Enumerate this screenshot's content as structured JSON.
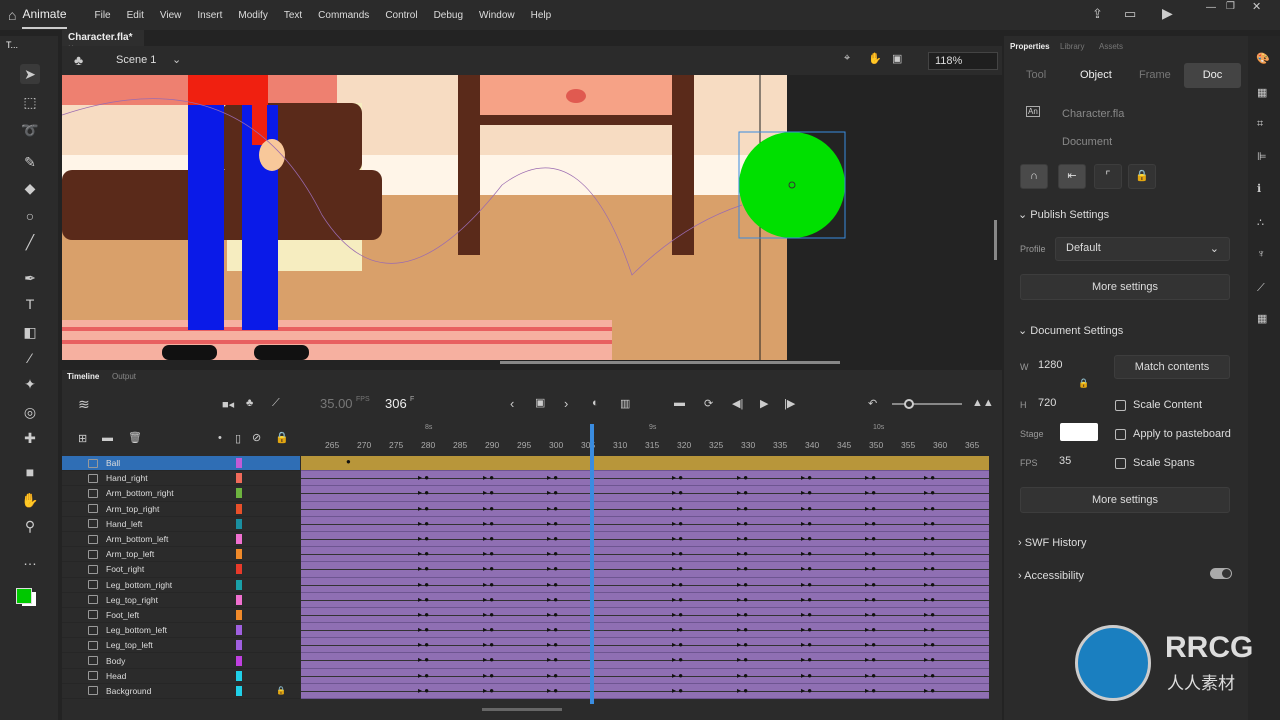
{
  "app": {
    "name": "Animate",
    "menu": [
      "File",
      "Edit",
      "View",
      "Insert",
      "Modify",
      "Text",
      "Commands",
      "Control",
      "Debug",
      "Window",
      "Help"
    ]
  },
  "tools_panel": {
    "title": "T..."
  },
  "document": {
    "tab": "Character.fla*",
    "scene": "Scene 1",
    "zoom": "118%"
  },
  "timeline": {
    "tabs": [
      "Timeline",
      "Output"
    ],
    "fps": "35.00",
    "fps_unit": "FPS",
    "frame": "306",
    "frame_unit": "F",
    "ruler": [
      "265",
      "270",
      "275",
      "280",
      "285",
      "290",
      "295",
      "300",
      "305",
      "310",
      "315",
      "320",
      "325",
      "330",
      "335",
      "340",
      "345",
      "350",
      "355",
      "360",
      "365"
    ],
    "seconds": [
      "8s",
      "9s",
      "10s"
    ],
    "current_frame": 306,
    "layers": [
      {
        "name": "Ball",
        "color": "#c35bd6"
      },
      {
        "name": "Hand_right",
        "color": "#f06a5a"
      },
      {
        "name": "Arm_bottom_right",
        "color": "#6db33f"
      },
      {
        "name": "Arm_top_right",
        "color": "#e8502a"
      },
      {
        "name": "Hand_left",
        "color": "#1a8fa0"
      },
      {
        "name": "Arm_bottom_left",
        "color": "#f070d0"
      },
      {
        "name": "Arm_top_left",
        "color": "#f08a2a"
      },
      {
        "name": "Foot_right",
        "color": "#e83a2a"
      },
      {
        "name": "Leg_bottom_right",
        "color": "#1aa0a8"
      },
      {
        "name": "Leg_top_right",
        "color": "#f070d0"
      },
      {
        "name": "Foot_left",
        "color": "#f08a2a"
      },
      {
        "name": "Leg_bottom_left",
        "color": "#a060e0"
      },
      {
        "name": "Leg_top_left",
        "color": "#a060e0"
      },
      {
        "name": "Body",
        "color": "#c040e0"
      },
      {
        "name": "Head",
        "color": "#20d0e8"
      },
      {
        "name": "Background",
        "color": "#20d0e8"
      }
    ]
  },
  "properties": {
    "tabs": [
      "Properties",
      "Library",
      "Assets"
    ],
    "subtabs": [
      "Tool",
      "Object",
      "Frame",
      "Doc"
    ],
    "active_subtab": "Doc",
    "file": "Character.fla",
    "type": "Document",
    "publish": {
      "title": "Publish Settings",
      "profile_label": "Profile",
      "profile": "Default",
      "more": "More settings"
    },
    "docset": {
      "title": "Document Settings",
      "w_label": "W",
      "w": "1280",
      "h_label": "H",
      "h": "720",
      "match": "Match contents",
      "scale_content": "Scale Content",
      "stage_label": "Stage",
      "stage_color": "#ffffff",
      "apply": "Apply to pasteboard",
      "fps_label": "FPS",
      "fps": "35",
      "scale_spans": "Scale Spans",
      "more": "More settings"
    },
    "swf": "SWF History",
    "accessibility": "Accessibility"
  },
  "watermark": {
    "brand": "RRCG",
    "sub": "人人素材"
  }
}
